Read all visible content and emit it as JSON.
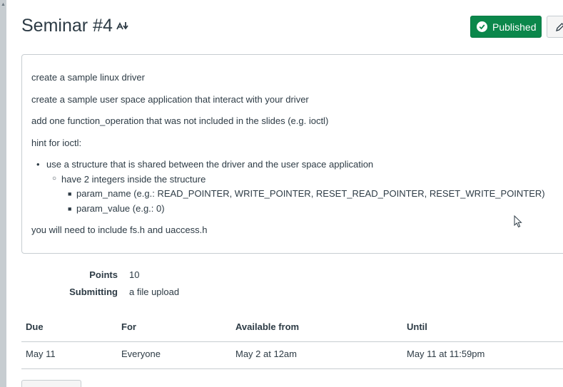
{
  "assignment": {
    "title": "Seminar #4",
    "mastery_icon": "mastery-path-icon",
    "published_label": "Published",
    "edit_icon": "pencil-icon"
  },
  "description": {
    "lines": [
      "create a sample linux driver",
      "create a sample user space application that interact with your driver",
      "add one function_operation that was not included in the slides (e.g. ioctl)",
      "hint for ioctl:"
    ],
    "bullet_1": "use a structure that is shared between the driver and the user space application",
    "bullet_1_1": "have 2 integers inside the structure",
    "bullet_1_1_1": "param_name (e.g.: READ_POINTER, WRITE_POINTER, RESET_READ_POINTER, RESET_WRITE_POINTER)",
    "bullet_1_1_2": "param_value (e.g.: 0)",
    "footer": "you will need to include fs.h and uaccess.h"
  },
  "details": {
    "points_label": "Points",
    "points_value": "10",
    "submitting_label": "Submitting",
    "submitting_value": "a file upload"
  },
  "dates": {
    "headers": [
      "Due",
      "For",
      "Available from",
      "Until"
    ],
    "row": [
      "May 11",
      "Everyone",
      "May 2 at 12am",
      "May 11 at 11:59pm"
    ]
  },
  "colors": {
    "published_green": "#0b874b",
    "text": "#2d3b45",
    "border": "#c7cdd1"
  }
}
